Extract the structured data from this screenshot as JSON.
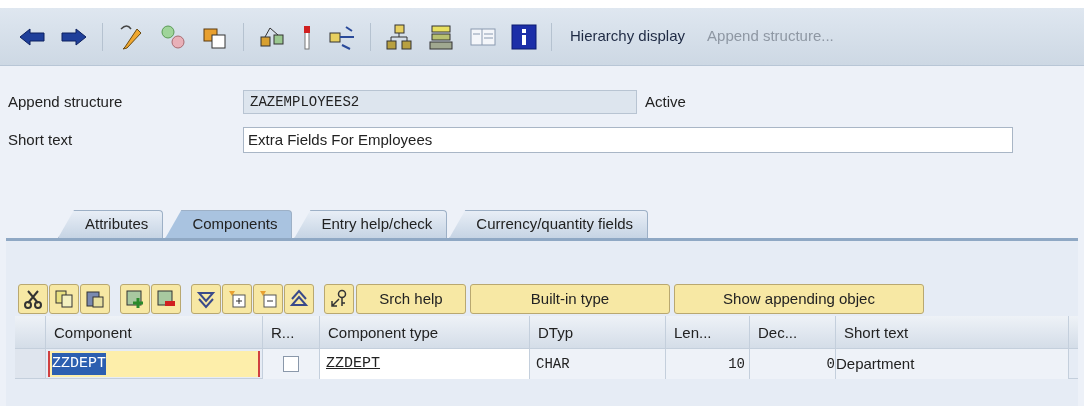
{
  "toolbar": {
    "functions": [
      {
        "label": "Hierarchy display",
        "disabled": false
      },
      {
        "label": "Append structure...",
        "disabled": true
      }
    ]
  },
  "fields": [
    {
      "label": "Append structure",
      "value": "ZAZEMPLOYEES2",
      "kind": "readonly",
      "status": "Active"
    },
    {
      "label": "Short text",
      "value": "Extra Fields For Employees",
      "kind": "input"
    }
  ],
  "tabs": [
    {
      "label": "Attributes",
      "selected": false
    },
    {
      "label": "Components",
      "selected": true
    },
    {
      "label": "Entry help/check",
      "selected": false
    },
    {
      "label": "Currency/quantity fields",
      "selected": false
    }
  ],
  "table_toolbar": {
    "buttons": [
      "Srch help",
      "Built-in type",
      "Show appending objec"
    ]
  },
  "table": {
    "columns": [
      "Component",
      "R...",
      "Component type",
      "DTyp",
      "Len...",
      "Dec...",
      "Short text"
    ],
    "rows": [
      {
        "component": "ZZDEPT",
        "focused": true,
        "checked": false,
        "component_type": "ZZDEPT",
        "dtyp": "CHAR",
        "length": "10",
        "decimals": "0",
        "short_text": "Department"
      }
    ]
  }
}
